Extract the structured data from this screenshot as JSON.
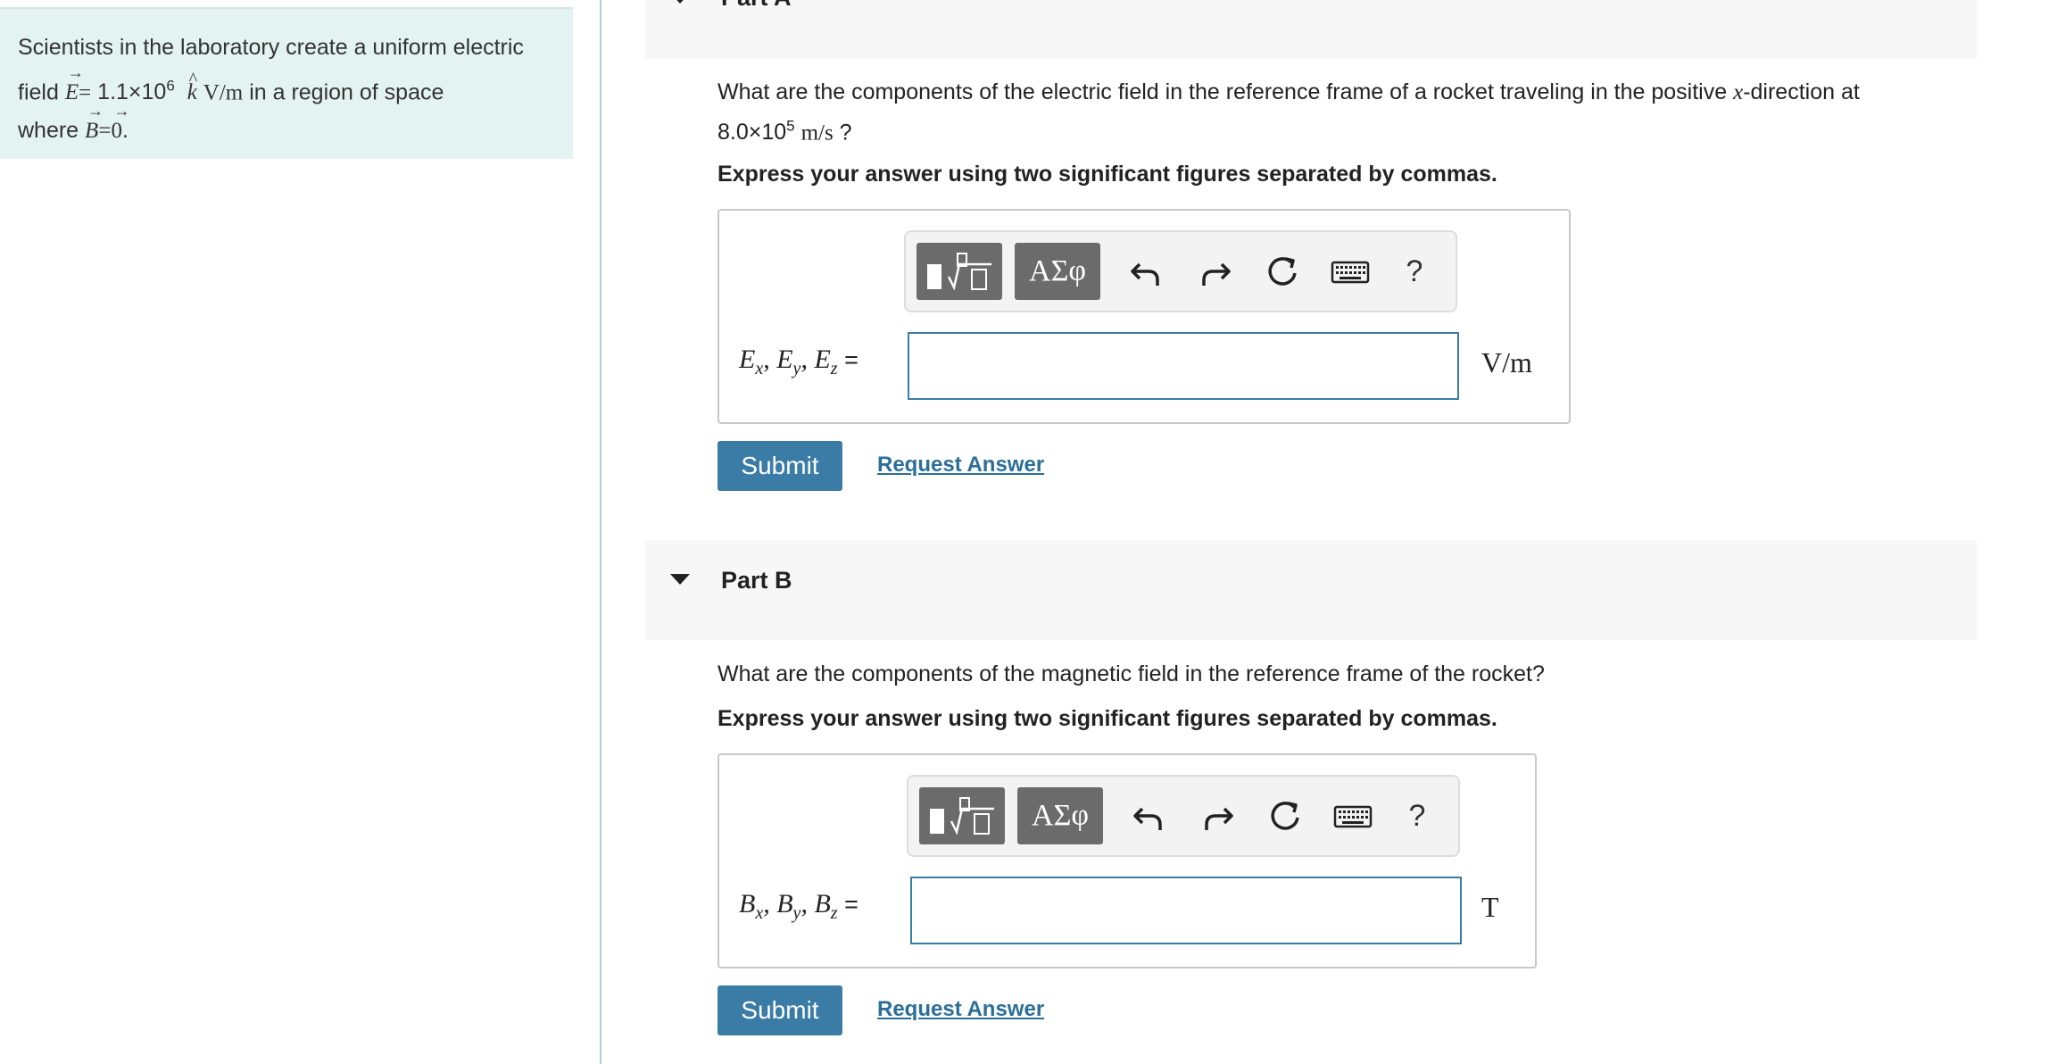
{
  "problem": {
    "text_line1": "Scientists in the laboratory create a uniform electric",
    "text_field_prefix": "field",
    "e_symbol": "E",
    "equals": "=",
    "e_mantissa": "1.1×10",
    "e_exponent": "6",
    "k_hat": "k",
    "e_unit": "V/m",
    "text_region": "in a region of space",
    "text_where": "where",
    "b_symbol": "B",
    "zero_vec": "0",
    "period": "."
  },
  "part_a": {
    "title": "Part A",
    "question_part1": "What are the components of the electric field in the reference frame of a rocket traveling in the positive",
    "question_x": "x",
    "question_part2": "-direction at",
    "velocity_mantissa": "8.0×10",
    "velocity_exponent": "5",
    "velocity_unit": "m/s",
    "question_mark": "?",
    "instruction": "Express your answer using two significant figures separated by commas.",
    "answer_label_base": "E",
    "answer_label_subs": [
      "x",
      "y",
      "z"
    ],
    "answer_equals": "=",
    "answer_value": "",
    "unit": "V/m",
    "submit_label": "Submit",
    "request_label": "Request Answer"
  },
  "part_b": {
    "title": "Part B",
    "question": "What are the components of the magnetic field in the reference frame of the rocket?",
    "instruction": "Express your answer using two significant figures separated by commas.",
    "answer_label_base": "B",
    "answer_label_subs": [
      "x",
      "y",
      "z"
    ],
    "answer_equals": "=",
    "answer_value": "",
    "unit": "T",
    "submit_label": "Submit",
    "request_label": "Request Answer"
  },
  "toolbar": {
    "symbols_label": "ΑΣφ",
    "help_label": "?",
    "icons": [
      "templates-icon",
      "undo-icon",
      "redo-icon",
      "reset-icon",
      "keyboard-icon",
      "help-icon"
    ]
  },
  "colors": {
    "problem_bg": "#e3f3f2",
    "accent": "#3a7ca5",
    "link": "#2a6f99",
    "header_bg": "#f7f7f7",
    "toolbar_btn": "#6b6b6b"
  }
}
